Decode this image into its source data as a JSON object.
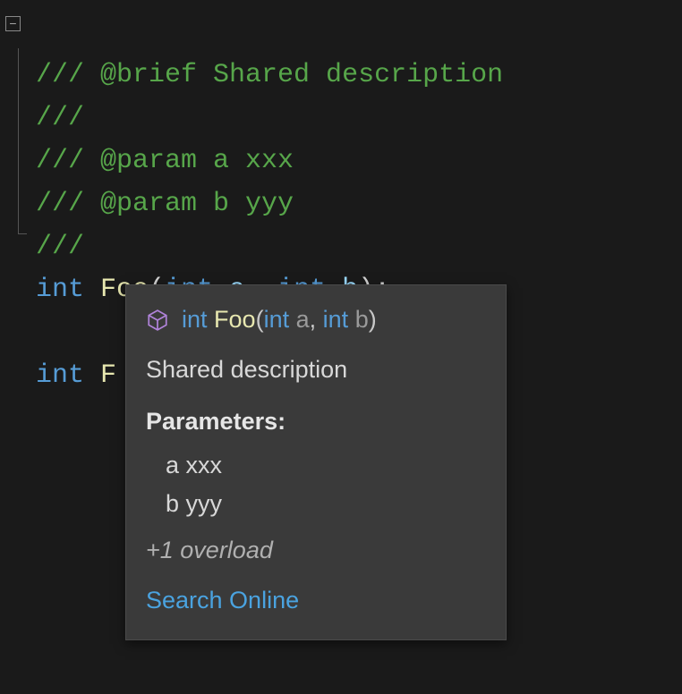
{
  "doc": {
    "line1_prefix": "///",
    "line1_text": " @brief Shared description",
    "line2": "///",
    "line3_prefix": "///",
    "line3_text": " @param a xxx",
    "line4_prefix": "///",
    "line4_text": " @param b yyy",
    "line5": "///"
  },
  "decl": {
    "kw_int1": "int",
    "space1": " ",
    "func": "Foo",
    "lparen": "(",
    "kw_int2": "int",
    "space2": " ",
    "param_a": "a",
    "comma": ", ",
    "kw_int3": "int",
    "space3": " ",
    "param_b": "b",
    "rparen_semi": ");"
  },
  "partial": {
    "kw_int": "int",
    "space": " ",
    "rest": "F"
  },
  "tooltip": {
    "sig": {
      "kw_int1": "int",
      "space1": " ",
      "func": "Foo",
      "lparen": "(",
      "kw_int2": "int",
      "space2": " ",
      "param_a": "a",
      "comma": ", ",
      "kw_int3": "int",
      "space3": " ",
      "param_b": "b",
      "rparen": ")"
    },
    "description": "Shared description",
    "params_heading": "Parameters:",
    "params": {
      "a": "a xxx",
      "b": "b yyy"
    },
    "overload": "+1 overload",
    "search_link": "Search Online"
  },
  "icons": {
    "fold": "minus-icon",
    "cube": "cube-icon"
  }
}
